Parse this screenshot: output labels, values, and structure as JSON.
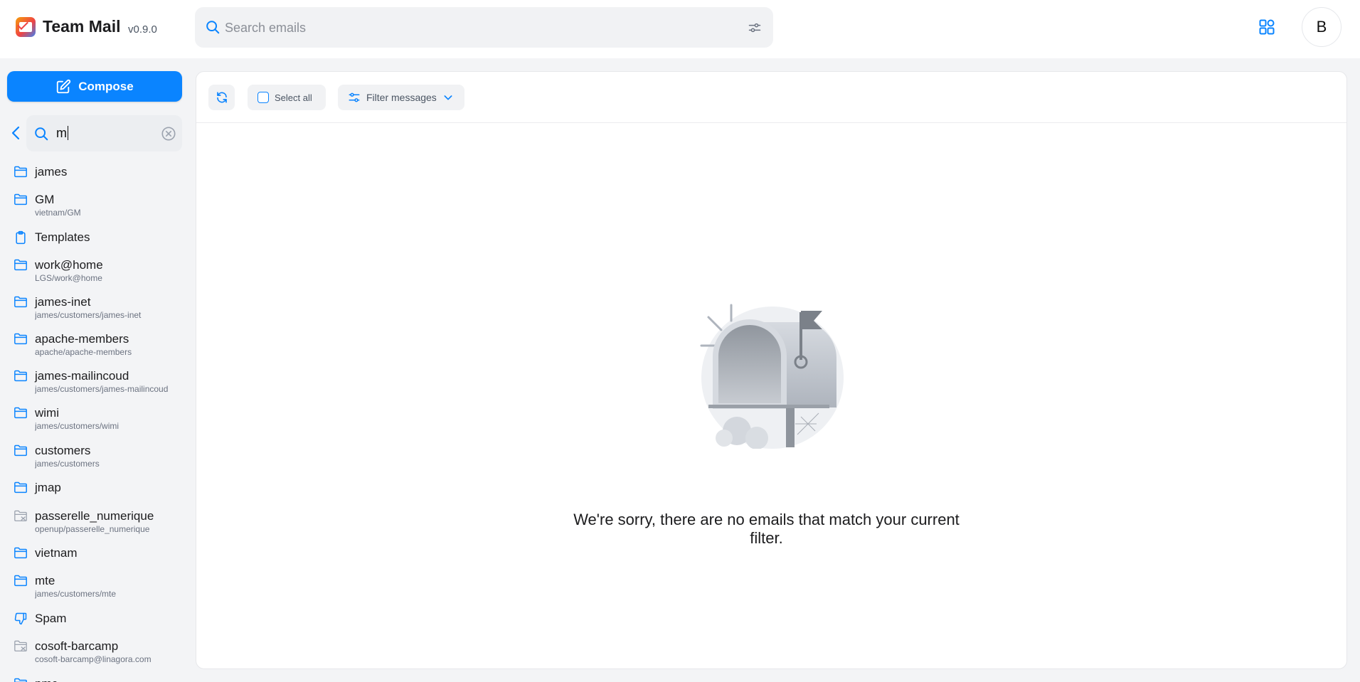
{
  "app": {
    "title": "Team Mail",
    "version": "v0.9.0"
  },
  "search": {
    "placeholder": "Search emails"
  },
  "user": {
    "avatar_initial": "B"
  },
  "sidebar": {
    "compose_label": "Compose",
    "folder_search_value": "m",
    "folders": [
      {
        "name": "james",
        "path": "",
        "icon": "folder-icon"
      },
      {
        "name": "GM",
        "path": "vietnam/GM",
        "icon": "folder-icon"
      },
      {
        "name": "Templates",
        "path": "",
        "icon": "clipboard-icon"
      },
      {
        "name": "work@home",
        "path": "LGS/work@home",
        "icon": "folder-icon"
      },
      {
        "name": "james-inet",
        "path": "james/customers/james-inet",
        "icon": "folder-icon"
      },
      {
        "name": "apache-members",
        "path": "apache/apache-members",
        "icon": "folder-icon"
      },
      {
        "name": "james-mailincoud",
        "path": "james/customers/james-mailincoud",
        "icon": "folder-icon"
      },
      {
        "name": "wimi",
        "path": "james/customers/wimi",
        "icon": "folder-icon"
      },
      {
        "name": "customers",
        "path": "james/customers",
        "icon": "folder-icon"
      },
      {
        "name": "jmap",
        "path": "",
        "icon": "folder-icon"
      },
      {
        "name": "passerelle_numerique",
        "path": "openup/passerelle_numerique",
        "icon": "folder-unsubscribed-icon"
      },
      {
        "name": "vietnam",
        "path": "",
        "icon": "folder-icon"
      },
      {
        "name": "mte",
        "path": "james/customers/mte",
        "icon": "folder-icon"
      },
      {
        "name": "Spam",
        "path": "",
        "icon": "thumbs-down-icon"
      },
      {
        "name": "cosoft-barcamp",
        "path": "cosoft-barcamp@linagora.com",
        "icon": "folder-unsubscribed-icon"
      },
      {
        "name": "pmc",
        "path": "",
        "icon": "folder-icon"
      }
    ]
  },
  "toolbar": {
    "select_all_label": "Select all",
    "filter_label": "Filter messages"
  },
  "empty_state": {
    "message": "We're sorry, there are no emails that match your current filter."
  },
  "colors": {
    "accent": "#0a84ff",
    "background": "#f3f4f6"
  }
}
